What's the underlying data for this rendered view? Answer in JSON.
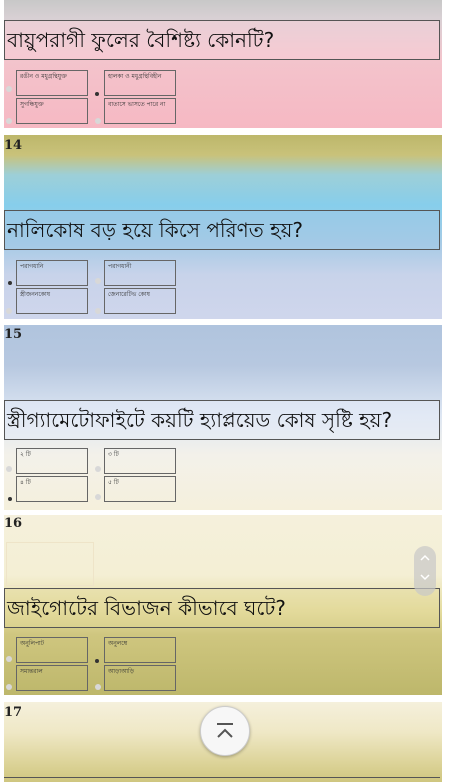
{
  "questions": [
    {
      "number": "",
      "text": "বায়ুপরাগী ফুলের বৈশিষ্ট্য কোনটি?",
      "options": [
        "রঙীন ও মধুগ্রন্থিযুক্ত",
        "হালকা ও মধুগ্রন্থিবিহীন",
        "সুগন্ধিযুক্ত",
        "বাতাসে ভাসতে পারে না"
      ]
    },
    {
      "number": "14",
      "text": "নালিকোষ বড় হয়ে কিসে পরিণত হয়?",
      "options": [
        "পরাগধানি",
        "পরাগধানী",
        "স্ত্রীজননকোষ",
        "জেনারেটিভ কোষ"
      ]
    },
    {
      "number": "15",
      "text": "স্ত্রীগ্যামেটোফাইটে কয়টি হ্যাপ্লয়েড কোষ সৃষ্টি হয়?",
      "options": [
        "২ টি",
        "৩ টি",
        "৪ টি",
        "৫ টি"
      ]
    },
    {
      "number": "16",
      "text": "জাইগোটের বিভাজন কীভাবে ঘটে?",
      "options": [
        "অনুলিপাট",
        "অনুলম্বে",
        "সমান্তরাল",
        "আড়াআড়ি"
      ]
    },
    {
      "number": "17",
      "text": "",
      "options": []
    }
  ],
  "colors": {
    "band_pink": "#f6b8c3",
    "band_olive": "#bdb76b",
    "band_skyblue": "#87ceeb",
    "band_steel": "#b0c4de",
    "band_cream": "#f5f0dc"
  },
  "icons": {
    "scroll_up": "chevron-up-icon",
    "scroll_down": "chevron-down-icon",
    "back_to_top": "arrow-up-icon"
  }
}
